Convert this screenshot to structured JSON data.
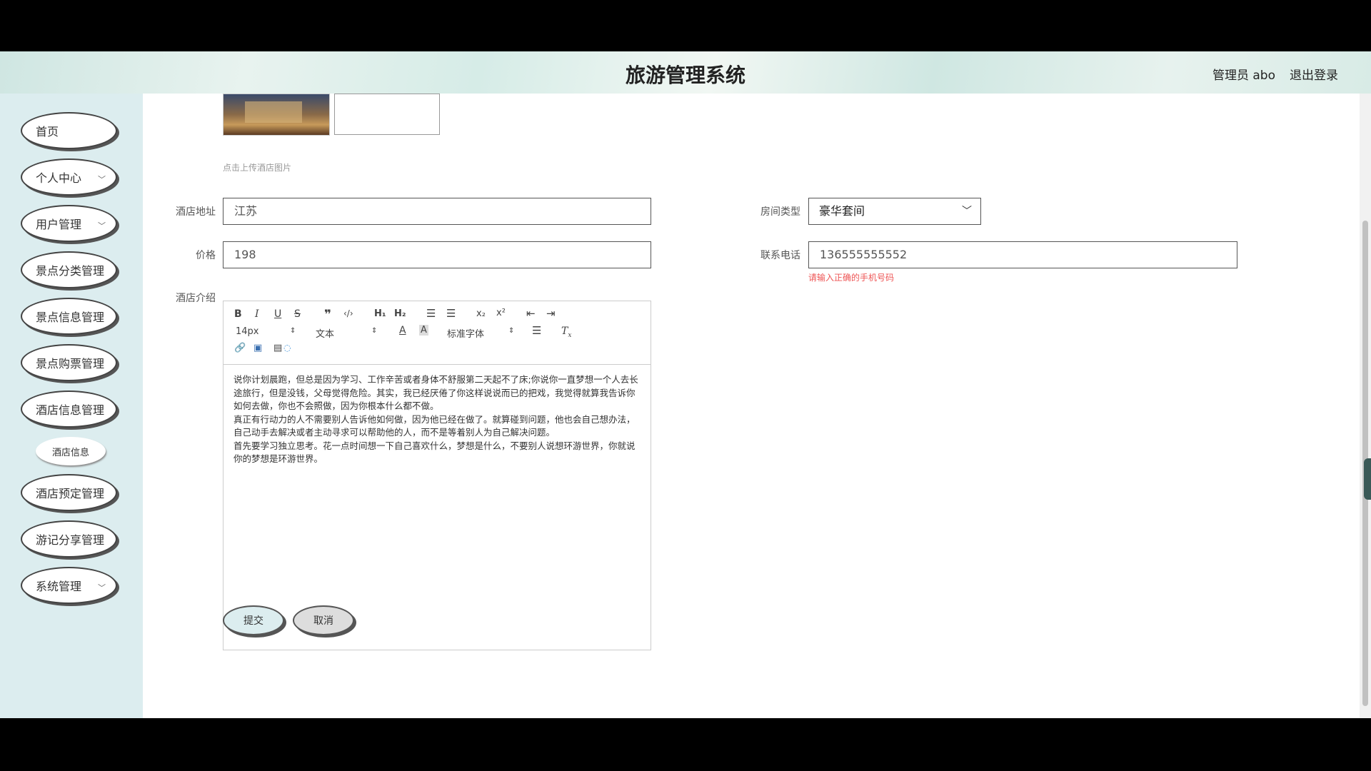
{
  "header": {
    "title": "旅游管理系统",
    "user": "管理员 abo",
    "logout": "退出登录"
  },
  "sidebar": {
    "items": [
      {
        "label": "首页"
      },
      {
        "label": "个人中心"
      },
      {
        "label": "用户管理"
      },
      {
        "label": "景点分类管理"
      },
      {
        "label": "景点信息管理"
      },
      {
        "label": "景点购票管理"
      },
      {
        "label": "酒店信息管理"
      },
      {
        "label": "酒店预定管理"
      },
      {
        "label": "游记分享管理"
      },
      {
        "label": "系统管理"
      }
    ],
    "sub_item": "酒店信息"
  },
  "form": {
    "upload_hint": "点击上传酒店图片",
    "address": {
      "label": "酒店地址",
      "value": "江苏"
    },
    "room_type": {
      "label": "房间类型",
      "value": "豪华套间"
    },
    "price": {
      "label": "价格",
      "value": "198"
    },
    "phone": {
      "label": "联系电话",
      "value": "136555555552",
      "error": "请输入正确的手机号码"
    },
    "intro": {
      "label": "酒店介绍",
      "font_size": "14px",
      "format": "文本",
      "font_family": "标准字体",
      "paragraphs": [
        "说你计划晨跑，但总是因为学习、工作辛苦或者身体不舒服第二天起不了床;你说你一直梦想一个人去长途旅行，但是没钱，父母觉得危险。其实，我已经厌倦了你这样说说而已的把戏，我觉得就算我告诉你如何去做，你也不会照做，因为你根本什么都不做。",
        "真正有行动力的人不需要别人告诉他如何做，因为他已经在做了。就算碰到问题，他也会自己想办法，自己动手去解决或者主动寻求可以帮助他的人，而不是等着别人为自己解决问题。",
        "首先要学习独立思考。花一点时间想一下自己喜欢什么，梦想是什么，不要别人说想环游世界，你就说你的梦想是环游世界。"
      ]
    },
    "submit": "提交",
    "cancel": "取消"
  }
}
